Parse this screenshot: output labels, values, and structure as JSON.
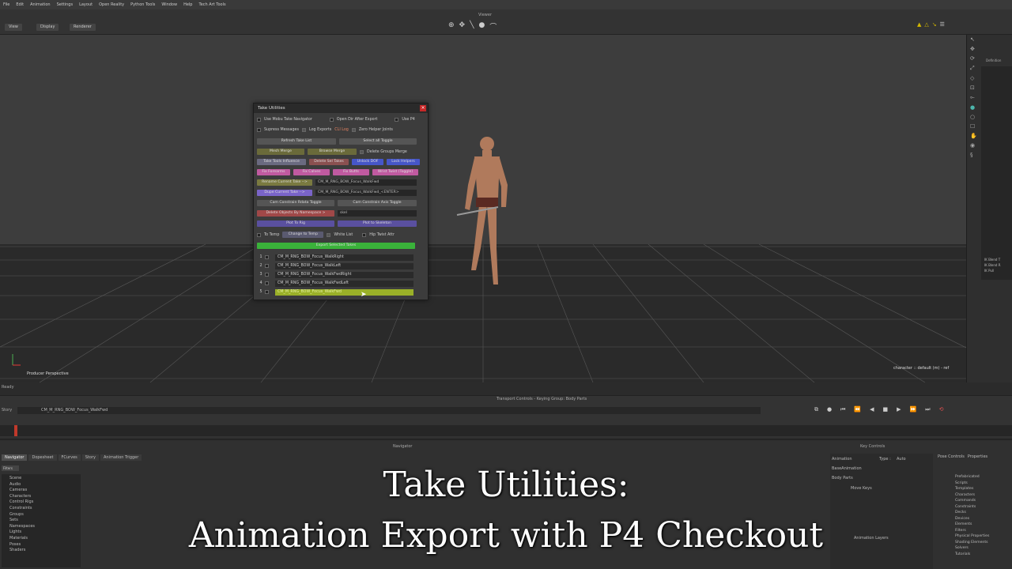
{
  "menubar": [
    "File",
    "Edit",
    "Animation",
    "Settings",
    "Layout",
    "Open Reality",
    "Python Tools",
    "Window",
    "Help",
    "Tech Art Tools"
  ],
  "toolbar": {
    "viewer_label": "Viewer",
    "view": "View",
    "display": "Display",
    "renderer": "Renderer"
  },
  "viewport": {
    "label_left": "Producer Perspective",
    "label_right": "character :: default (m) - ref"
  },
  "status": {
    "ready": "Ready"
  },
  "dialog": {
    "title": "Take Utilities",
    "row1": {
      "use_mobu": "Use Mobu Take Navigator",
      "open_dir": "Open Dir After Export",
      "use_p4": "Use P4"
    },
    "row2": {
      "suppress": "Supress Messages",
      "log_exports": "Log Exports",
      "cli_log": "CLI Log",
      "zero_helper": "Zero Helper Joints"
    },
    "refresh": "Refresh Take List",
    "select_all": "Select all Toggle",
    "mesh_merge": "Mesh Merge",
    "browse_merge": "Browse Merge",
    "delete_groups": "Delete Groups Merge",
    "take_tools": "Take Tools Influence",
    "delete_sel": "Delete Sel Takes",
    "unlock_dof": "Unlock DOF",
    "lock_helpers": "Lock Helpers",
    "fix_forearms": "Fix Forearms",
    "fix_calves": "Fix Calves",
    "fix_butts": "Fix Butts",
    "wrist_twist": "Wrist Twist (Toggle)",
    "rename_take": "Rename Current Take -->",
    "rename_value": "CM_M_RNG_BOW_Focus_WalkFwd",
    "dupe_take": "Dupe Current Take -->",
    "dupe_value": "CM_M_RNG_BOW_Focus_WalkFwd_<ENTER>",
    "cam_rig": "Cam Constrain Rdata Toggle",
    "cam_axis": "Cam Constrain Axis Toggle",
    "delete_objects": "Delete Objects By Namespace  >",
    "delete_value": "skel",
    "plot_rig": "Plot To Rig",
    "plot_skel": "Plot to Skeleton",
    "row_last": {
      "to_temp": "To Temp",
      "change_temp": "Change to Temp",
      "white_list": "White List",
      "hip_twist": "Hip Twist Attr"
    },
    "export": "Export Selected Takes",
    "takes": [
      {
        "n": "1",
        "name": "CM_M_RNG_BOW_Focus_WalkRight"
      },
      {
        "n": "2",
        "name": "CM_M_RNG_BOW_Focus_WalkLeft"
      },
      {
        "n": "3",
        "name": "CM_M_RNG_BOW_Focus_WalkFwdRight"
      },
      {
        "n": "4",
        "name": "CM_M_RNG_BOW_Focus_WalkFwdLeft"
      },
      {
        "n": "5",
        "name": "CM_M_RNG_BOW_Focus_WalkFwd"
      }
    ]
  },
  "transport": {
    "label": "Transport Controls - Keying Group: Body Parts",
    "story": "Story",
    "take": "CM_M_RNG_BOW_Focus_WalkFwd"
  },
  "navigator": {
    "label": "Navigator",
    "tabs": [
      "Navigator",
      "Dopesheet",
      "FCurves",
      "Story",
      "Animation Trigger"
    ],
    "filter": "Filters",
    "tree": [
      "Scene",
      "Audio",
      "Cameras",
      "Characters",
      "Control Rigs",
      "Constraints",
      "Groups",
      "Sets",
      "Namespaces",
      "Lights",
      "Materials",
      "Poses",
      "Shaders"
    ]
  },
  "key_controls": {
    "label": "Key Controls",
    "animation": "Animation",
    "type": "Type :",
    "type_val": "Auto",
    "base": "BaseAnimation",
    "body": "Body Parts",
    "move_keys": "Move Keys",
    "layers": "Animation Layers"
  },
  "resources": {
    "tabs": [
      "Pose Controls",
      "Properties"
    ],
    "tree": [
      "Prefabricated",
      "Scripts",
      "Templates",
      "Characters",
      "Commands",
      "Constraints",
      "Decks",
      "Devices",
      "Elements",
      "Filters",
      "Physical Properties",
      "Shading Elements",
      "Solvers",
      "Tutorials"
    ]
  },
  "right_panel": {
    "definition": "Definition",
    "labels": [
      "IK Blend T",
      "IK Blend R",
      "IK Pull"
    ]
  },
  "caption": {
    "line1": "Take Utilities:",
    "line2": "Animation Export with P4 Checkout"
  }
}
